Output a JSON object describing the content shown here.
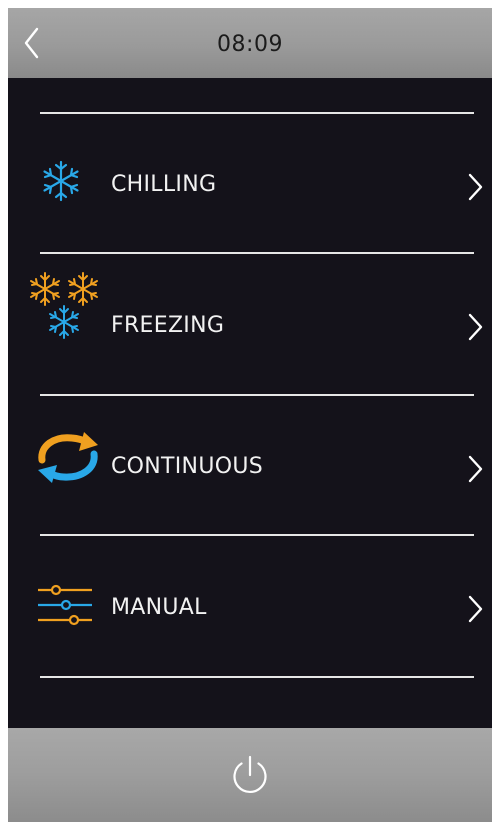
{
  "header": {
    "time": "08:09",
    "back_icon": "chevron-left-icon"
  },
  "menu": {
    "items": [
      {
        "label": "CHILLING",
        "icon": "snowflake-icon",
        "icon_color": "#29a8e8"
      },
      {
        "label": "FREEZING",
        "icon": "triple-snowflake-icon",
        "icon_colors": [
          "#f0a020",
          "#29a8e8"
        ]
      },
      {
        "label": "CONTINUOUS",
        "icon": "cycle-arrows-icon",
        "icon_colors": [
          "#f0a020",
          "#29a8e8"
        ]
      },
      {
        "label": "MANUAL",
        "icon": "sliders-icon",
        "icon_colors": [
          "#f0a020",
          "#29a8e8"
        ]
      }
    ],
    "chevron_icon": "chevron-right-icon"
  },
  "footer": {
    "power_icon": "power-icon"
  },
  "colors": {
    "background": "#14121a",
    "bar_gray": "#9d9d9d",
    "text": "#f2f2f2",
    "accent_blue": "#29a8e8",
    "accent_orange": "#f0a020"
  }
}
